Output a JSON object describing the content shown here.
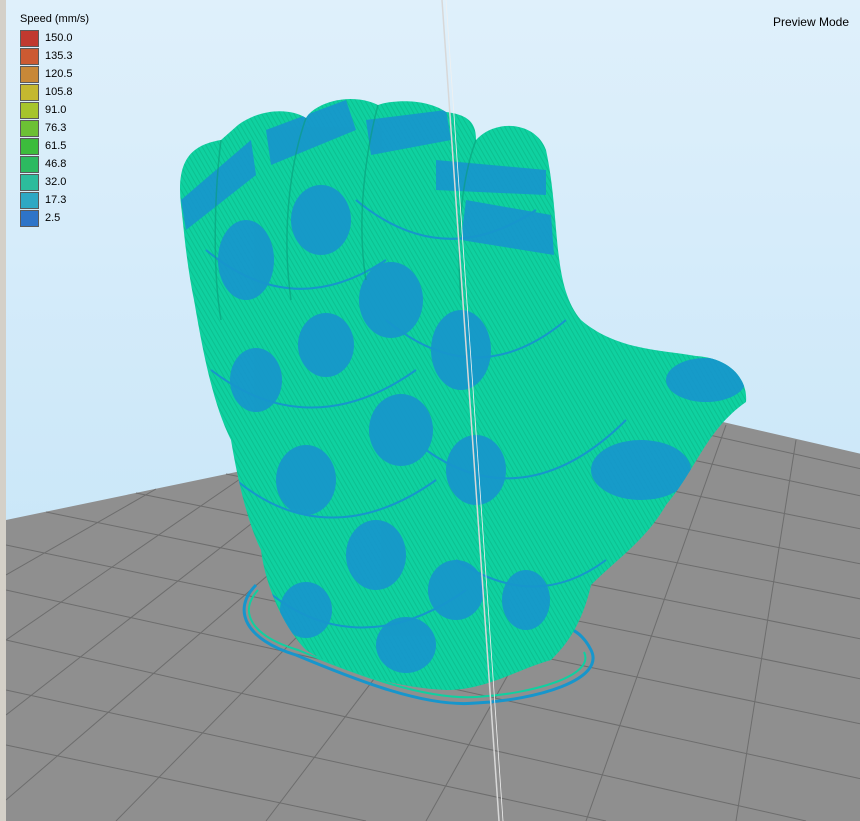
{
  "viewport": {
    "mode_label": "Preview Mode"
  },
  "legend": {
    "title": "Speed (mm/s)",
    "items": [
      {
        "label": "150.0",
        "color": "#c0392f"
      },
      {
        "label": "135.3",
        "color": "#cc5a32"
      },
      {
        "label": "120.5",
        "color": "#c88838"
      },
      {
        "label": "105.8",
        "color": "#c4b830"
      },
      {
        "label": "91.0",
        "color": "#a6c42c"
      },
      {
        "label": "76.3",
        "color": "#6cc034"
      },
      {
        "label": "61.5",
        "color": "#3cbc3c"
      },
      {
        "label": "46.8",
        "color": "#2cba60"
      },
      {
        "label": "32.0",
        "color": "#2cbc9c"
      },
      {
        "label": "17.3",
        "color": "#2ea8c4"
      },
      {
        "label": "2.5",
        "color": "#2e74c8"
      }
    ]
  },
  "colors": {
    "background": "#cfe8f8",
    "bed": "#8c8c8c",
    "grid_line": "#6f6f6f",
    "model_fast": "#10d0a0",
    "model_slow": "#1796cc"
  }
}
